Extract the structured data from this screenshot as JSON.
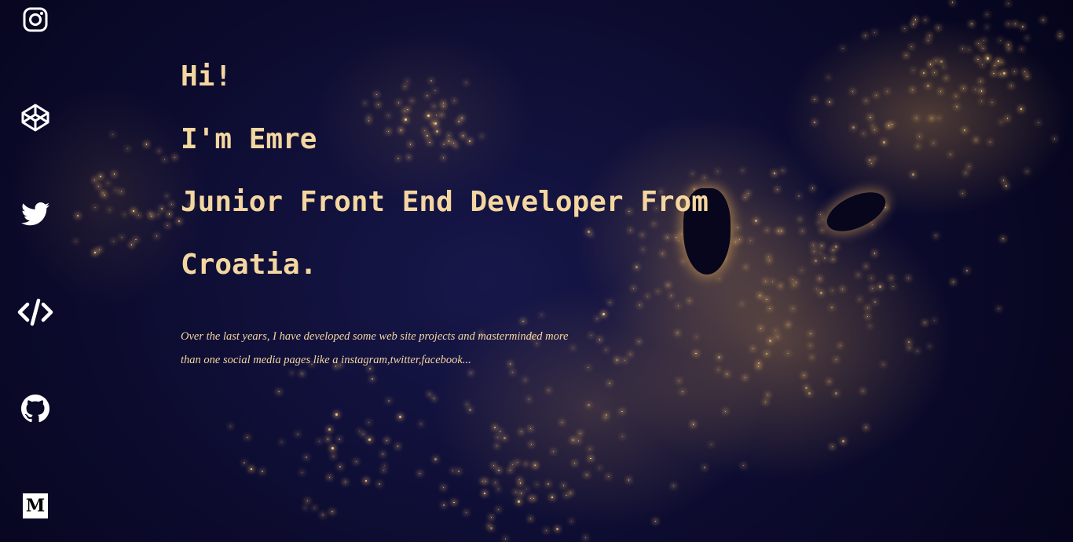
{
  "sidebar": {
    "links": [
      {
        "name": "instagram",
        "icon": "instagram-icon"
      },
      {
        "name": "codepen",
        "icon": "codepen-icon"
      },
      {
        "name": "twitter",
        "icon": "twitter-icon"
      },
      {
        "name": "code",
        "icon": "code-icon"
      },
      {
        "name": "github",
        "icon": "github-icon"
      },
      {
        "name": "medium",
        "icon": "medium-icon",
        "glyph": "M"
      }
    ]
  },
  "hero": {
    "line1": "Hi!",
    "line2": "I'm Emre",
    "line3": "Junior Front End Developer From",
    "line4": "Croatia.",
    "intro": "Over the last years, I have developed some web site projects and masterminded more than one social media pages like a instagram,twitter,facebook..."
  },
  "colors": {
    "accent_text": "#f4d6a0",
    "background": "#05041a",
    "icon": "#ffffff"
  }
}
